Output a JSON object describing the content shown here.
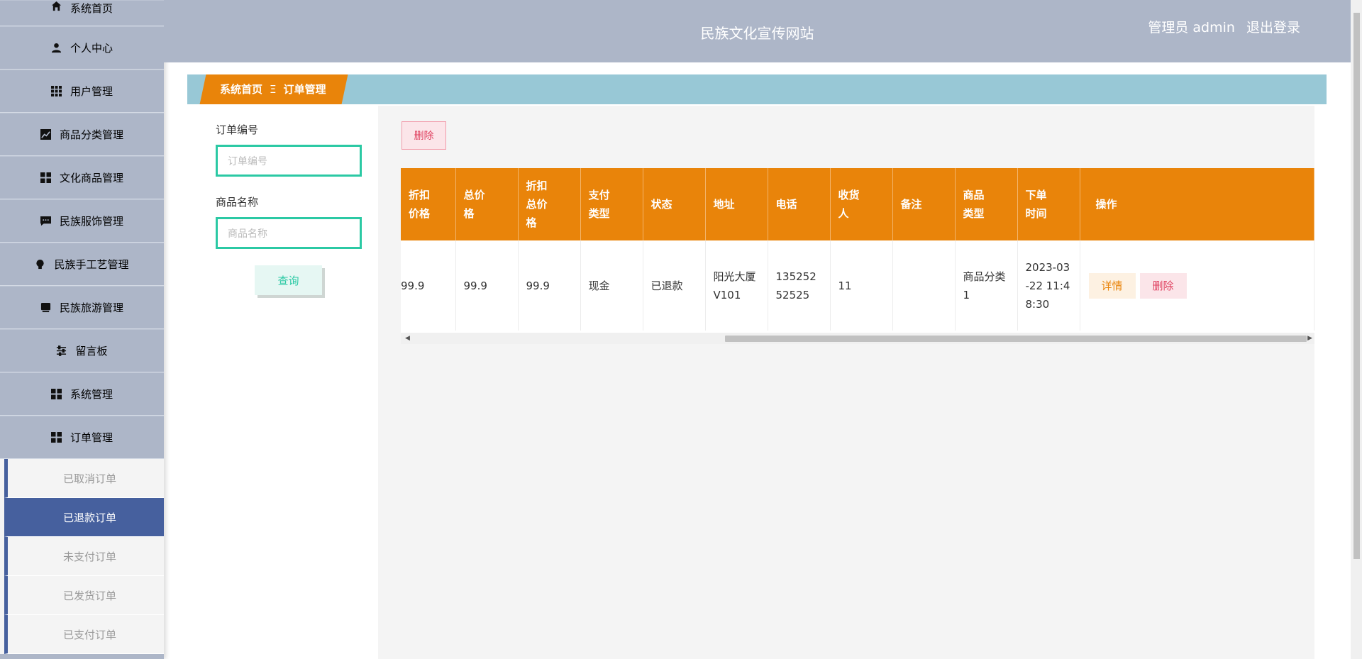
{
  "header": {
    "title": "民族文化宣传网站",
    "user": "管理员 admin",
    "logout": "退出登录"
  },
  "sidebar": {
    "items": [
      {
        "label": "系统首页",
        "icon": "home-icon"
      },
      {
        "label": "个人中心",
        "icon": "user-icon"
      },
      {
        "label": "用户管理",
        "icon": "grid-icon"
      },
      {
        "label": "商品分类管理",
        "icon": "chart-icon"
      },
      {
        "label": "文化商品管理",
        "icon": "apps-icon"
      },
      {
        "label": "民族服饰管理",
        "icon": "message-icon"
      },
      {
        "label": "民族手工艺管理",
        "icon": "bulb-icon"
      },
      {
        "label": "民族旅游管理",
        "icon": "ticket-icon"
      },
      {
        "label": "留言板",
        "icon": "sliders-icon"
      },
      {
        "label": "系统管理",
        "icon": "apps-icon"
      },
      {
        "label": "订单管理",
        "icon": "apps-icon"
      }
    ],
    "sub_items": [
      {
        "label": "已取消订单",
        "active": false
      },
      {
        "label": "已退款订单",
        "active": true
      },
      {
        "label": "未支付订单",
        "active": false
      },
      {
        "label": "已发货订单",
        "active": false
      },
      {
        "label": "已支付订单",
        "active": false
      }
    ]
  },
  "breadcrumb": {
    "home": "系统首页",
    "separator": "Ξ",
    "current": "订单管理"
  },
  "search": {
    "order_no_label": "订单编号",
    "order_no_placeholder": "订单编号",
    "product_name_label": "商品名称",
    "product_name_placeholder": "商品名称",
    "query_label": "查询"
  },
  "toolbar": {
    "delete_label": "删除"
  },
  "table": {
    "headers": [
      "折扣\n价格",
      "总价\n格",
      "折扣\n总价\n格",
      "支付\n类型",
      "状态",
      "地址",
      "电话",
      "收货\n人",
      "备注",
      "商品\n类型",
      "下单\n时间",
      "操作"
    ],
    "rows": [
      {
        "discount_price": "99.9",
        "total_price": "99.9",
        "discount_total": "99.9",
        "pay_type": "现金",
        "status": "已退款",
        "address": "阳光大厦V101",
        "phone": "13525252525",
        "receiver": "11",
        "remark": "",
        "product_type": "商品分类1",
        "order_time": "2023-03-22 11:48:30",
        "detail_label": "详情",
        "delete_label": "删除"
      }
    ]
  },
  "colors": {
    "sidebar_bg": "#adb6c8",
    "accent_orange": "#e9840a",
    "teal": "#2bc9a4",
    "crumb_bar": "#98c8d6",
    "active_sub": "#46609e",
    "danger": "#e04160"
  }
}
